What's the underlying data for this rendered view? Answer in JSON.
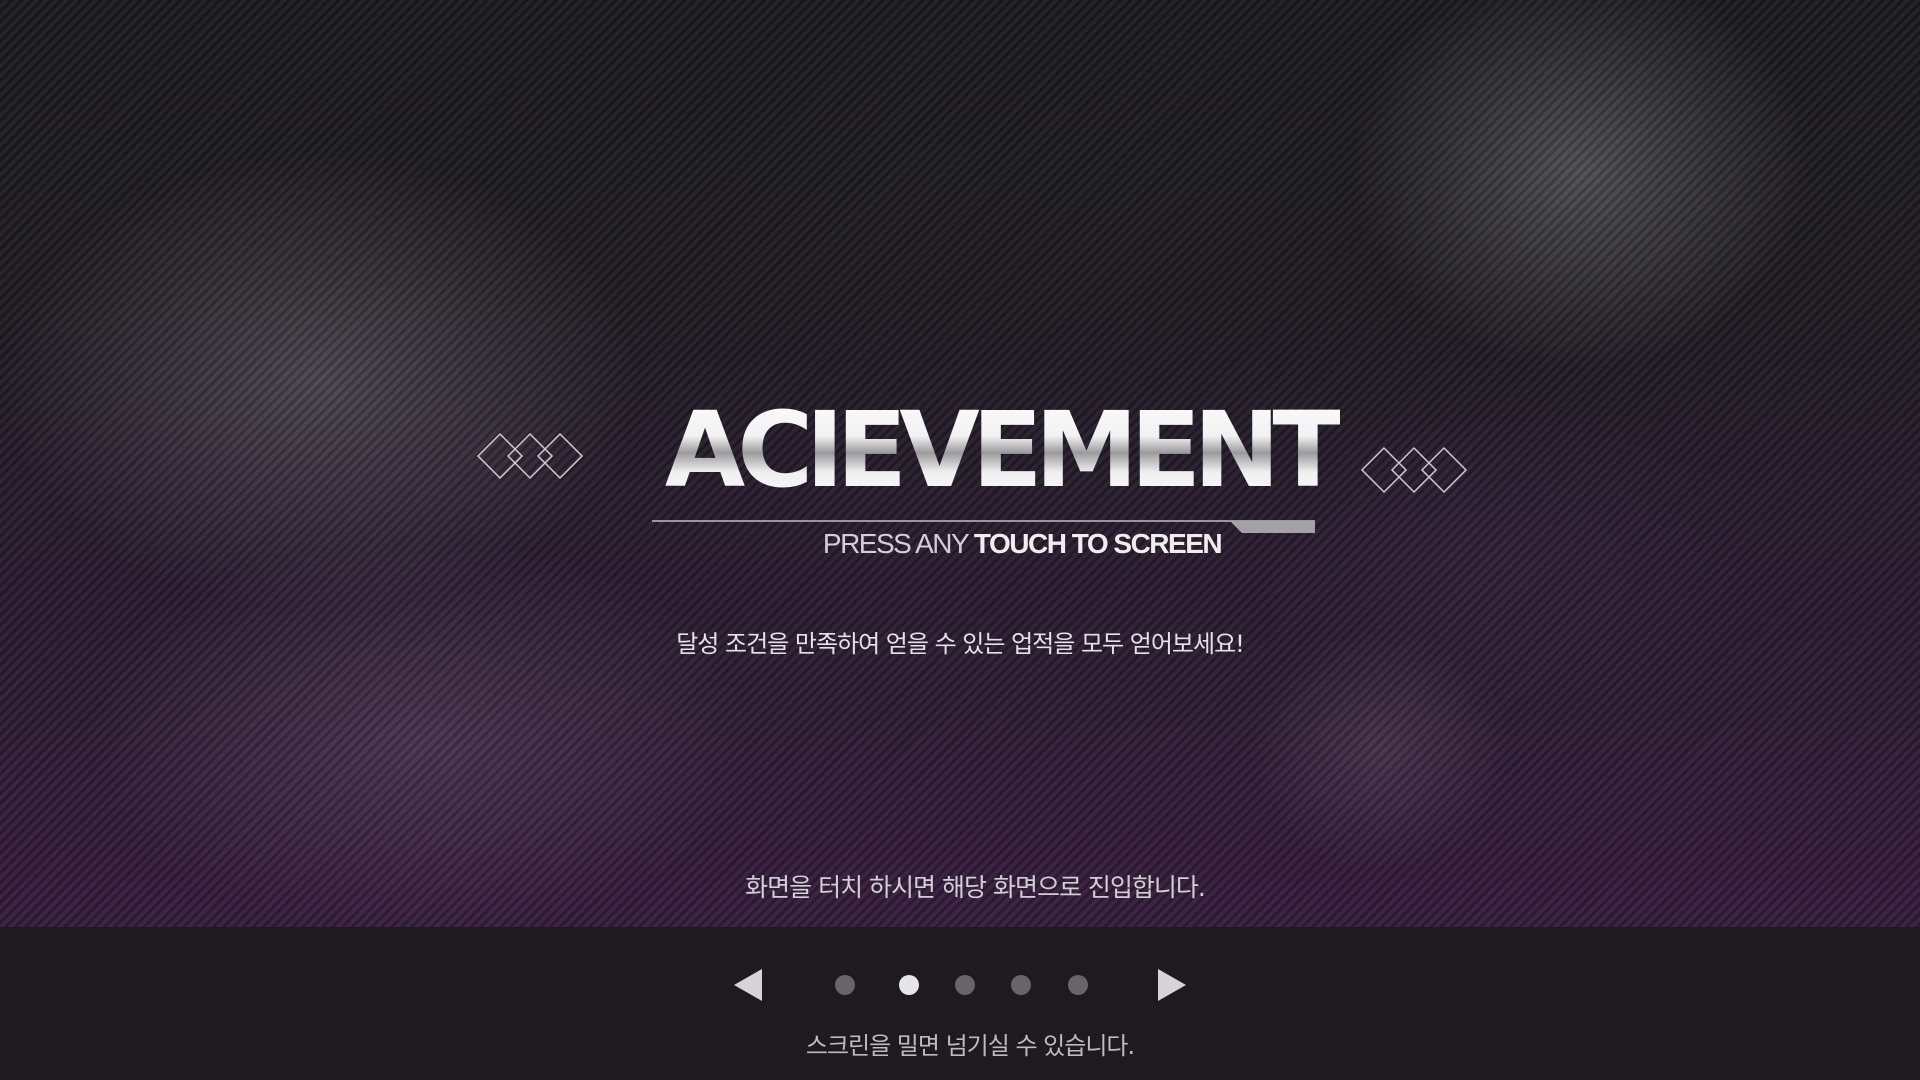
{
  "screen": {
    "title": "ACIEVEMENT",
    "subtitle_normal": "PRESS ANY",
    "subtitle_bold": "TOUCH TO SCREEN",
    "description": "달성 조건을 만족하여 얻을 수 있는 업적을 모두 얻어보세요!",
    "touch_hint": "화면을 터치 하시면 해당 화면으로 진입합니다."
  },
  "pager": {
    "prev_icon": "triangle-left-icon",
    "next_icon": "triangle-right-icon",
    "page_count": 5,
    "current_page": 2,
    "swipe_hint": "스크린을 밀면 넘기실 수 있습니다."
  },
  "colors": {
    "dot_inactive": "#67646a",
    "dot_active": "#e6e5e8",
    "bottom_bar": "#1e1b20"
  }
}
